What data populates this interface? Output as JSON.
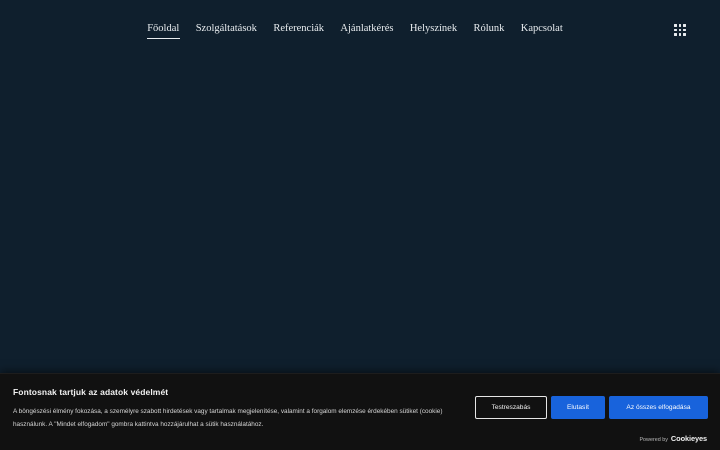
{
  "nav": {
    "items": [
      {
        "label": "Főoldal",
        "active": true
      },
      {
        "label": "Szolgáltatások",
        "active": false
      },
      {
        "label": "Referenciák",
        "active": false
      },
      {
        "label": "Ajánlatkérés",
        "active": false
      },
      {
        "label": "Helyszínek",
        "active": false
      },
      {
        "label": "Rólunk",
        "active": false
      },
      {
        "label": "Kapcsolat",
        "active": false
      }
    ],
    "menu_icon": "grid-menu-icon"
  },
  "colors": {
    "page_background": "#0f1f2d",
    "banner_background": "#111111",
    "primary_button": "#1863dc"
  },
  "cookie_banner": {
    "title": "Fontosnak tartjuk az adatok védelmét",
    "text": "A böngészési élmény fokozása, a személyre szabott hirdetések vagy tartalmak megjelenítése, valamint a forgalom elemzése érdekében sütiket (cookie) használunk. A \"Mindet elfogadom\" gombra kattintva hozzájárulhat a sütik használatához.",
    "customize_label": "Testreszabás",
    "reject_label": "Elutasít",
    "accept_label": "Az összes elfogadása",
    "powered_by_label": "Powered by",
    "powered_by_brand": "Cookieyes"
  }
}
